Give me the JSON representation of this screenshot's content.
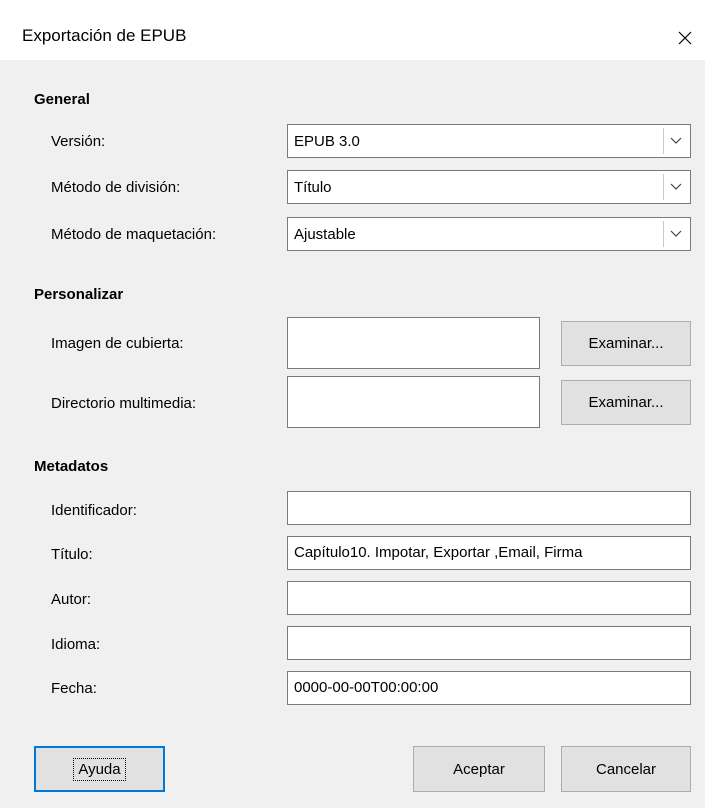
{
  "window": {
    "title": "Exportación de EPUB"
  },
  "general": {
    "heading": "General",
    "version_label": "Versión:",
    "version_value": "EPUB 3.0",
    "split_label": "Método de división:",
    "split_value": "Título",
    "layout_label": "Método de maquetación:",
    "layout_value": "Ajustable"
  },
  "customize": {
    "heading": "Personalizar",
    "cover_label": "Imagen de cubierta:",
    "cover_value": "",
    "media_label": "Directorio multimedia:",
    "media_value": "",
    "browse_label": "Examinar..."
  },
  "metadata": {
    "heading": "Metadatos",
    "identifier_label": "Identificador:",
    "identifier_value": "",
    "title_label": "Título:",
    "title_value": "Capítulo10. Impotar, Exportar ,Email, Firma",
    "author_label": "Autor:",
    "author_value": "",
    "language_label": "Idioma:",
    "language_value": "",
    "date_label": "Fecha:",
    "date_value": "0000-00-00T00:00:00"
  },
  "buttons": {
    "help": "Ayuda",
    "ok": "Aceptar",
    "cancel": "Cancelar"
  },
  "colors": {
    "accent": "#0078d7",
    "background": "#f0f0f0"
  }
}
